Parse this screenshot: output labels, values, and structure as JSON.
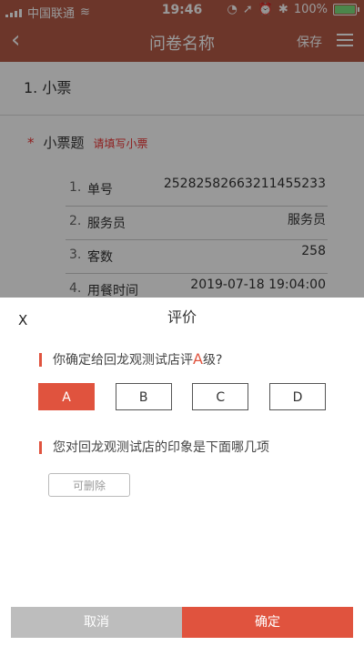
{
  "status": {
    "carrier": "中国联通",
    "time": "19:46",
    "battery_pct": "100%"
  },
  "nav": {
    "back_icon": "‹",
    "title": "问卷名称",
    "save_label": "保存"
  },
  "section": {
    "title": "1. 小票"
  },
  "question": {
    "star": "*",
    "title": "小票题",
    "hint": "请填写小票"
  },
  "fields": [
    {
      "num": "1.",
      "label": "单号",
      "value": "25282582663211455233"
    },
    {
      "num": "2.",
      "label": "服务员",
      "value": "服务员"
    },
    {
      "num": "3.",
      "label": "客数",
      "value": "258"
    },
    {
      "num": "4.",
      "label": "用餐时间",
      "value": "2019-07-18 19:04:00"
    }
  ],
  "sheet": {
    "close_label": "X",
    "title": "评价",
    "q1_prefix": "你确定给回龙观测试店评",
    "q1_grade": "A",
    "q1_suffix": "级?",
    "options": [
      "A",
      "B",
      "C",
      "D"
    ],
    "selected": "A",
    "q2": "您对回龙观测试店的印象是下面哪几项",
    "chip": "可删除",
    "cancel_label": "取消",
    "confirm_label": "确定"
  },
  "colors": {
    "brand": "#b45a47",
    "accent": "#e0533e"
  }
}
